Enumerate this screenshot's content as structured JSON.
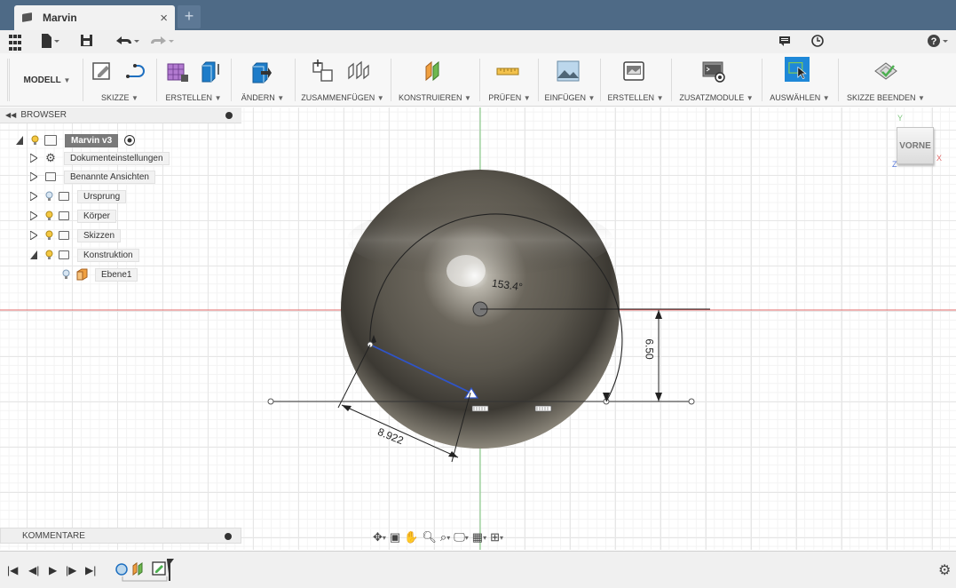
{
  "tab": {
    "title": "Marvin",
    "close": "×",
    "new": "+"
  },
  "ribbon": {
    "mode": "MODELL",
    "groups": [
      {
        "label": "SKIZZE",
        "icon": "sketch-icon"
      },
      {
        "label": "ERSTELLEN",
        "icon": "create-solid-icon"
      },
      {
        "label": "ÄNDERN",
        "icon": "modify-icon"
      },
      {
        "label": "ZUSAMMENFÜGEN",
        "icon": "assemble-icon"
      },
      {
        "label": "KONSTRUIEREN",
        "icon": "construct-icon"
      },
      {
        "label": "PRÜFEN",
        "icon": "inspect-icon"
      },
      {
        "label": "EINFÜGEN",
        "icon": "insert-icon"
      },
      {
        "label": "ERSTELLEN",
        "icon": "make-icon"
      },
      {
        "label": "ZUSATZMODULE",
        "icon": "addins-icon"
      },
      {
        "label": "AUSWÄHLEN",
        "icon": "select-icon"
      },
      {
        "label": "SKIZZE BEENDEN",
        "icon": "stop-sketch-icon"
      }
    ]
  },
  "browser": {
    "title": "BROWSER",
    "root": "Marvin v3",
    "items": [
      {
        "label": "Dokumenteinstellungen"
      },
      {
        "label": "Benannte Ansichten"
      },
      {
        "label": "Ursprung"
      },
      {
        "label": "Körper"
      },
      {
        "label": "Skizzen"
      },
      {
        "label": "Konstruktion"
      },
      {
        "label": "Ebene1"
      }
    ]
  },
  "comments": {
    "title": "KOMMENTARE"
  },
  "viewcube": {
    "face": "VORNE",
    "axis_y": "Y",
    "axis_x": "X",
    "axis_z": "Z"
  },
  "sketch": {
    "angle": "153.4°",
    "vertical_dim": "6.50",
    "length_dim": "8.922"
  },
  "colors": {
    "titlebar": "#4e6a86",
    "select_active": "#1e88d8",
    "x_axis": "#e36a6a",
    "y_axis": "#7bc47b"
  }
}
